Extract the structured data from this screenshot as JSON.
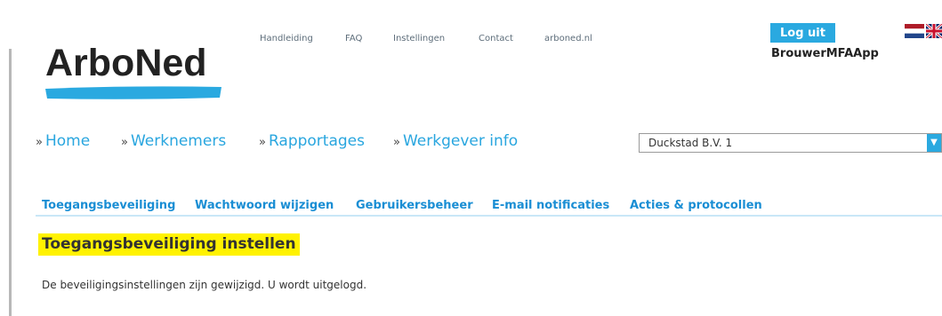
{
  "brand": {
    "name": "ArboNed"
  },
  "top_nav": [
    "Handleiding",
    "FAQ",
    "Instellingen",
    "Contact",
    "arboned.nl"
  ],
  "account": {
    "logout_label": "Log uit",
    "username": "BrouwerMFAApp"
  },
  "languages": [
    "nl-flag-icon",
    "uk-flag-icon"
  ],
  "main_nav": {
    "arrow": "»",
    "items": [
      "Home",
      "Werknemers",
      "Rapportages",
      "Werkgever info"
    ]
  },
  "company_select": {
    "value": "Duckstad B.V. 1"
  },
  "sub_nav": [
    "Toegangsbeveiliging",
    "Wachtwoord wijzigen",
    "Gebruikersbeheer",
    "E-mail notificaties",
    "Acties & protocollen"
  ],
  "page": {
    "title": "Toegangsbeveiliging instellen",
    "message": "De beveiligingsinstellingen zijn gewijzigd. U wordt uitgelogd."
  },
  "colors": {
    "accent": "#2aa9e0",
    "highlight": "#fff200",
    "link": "#1a8ed4"
  }
}
